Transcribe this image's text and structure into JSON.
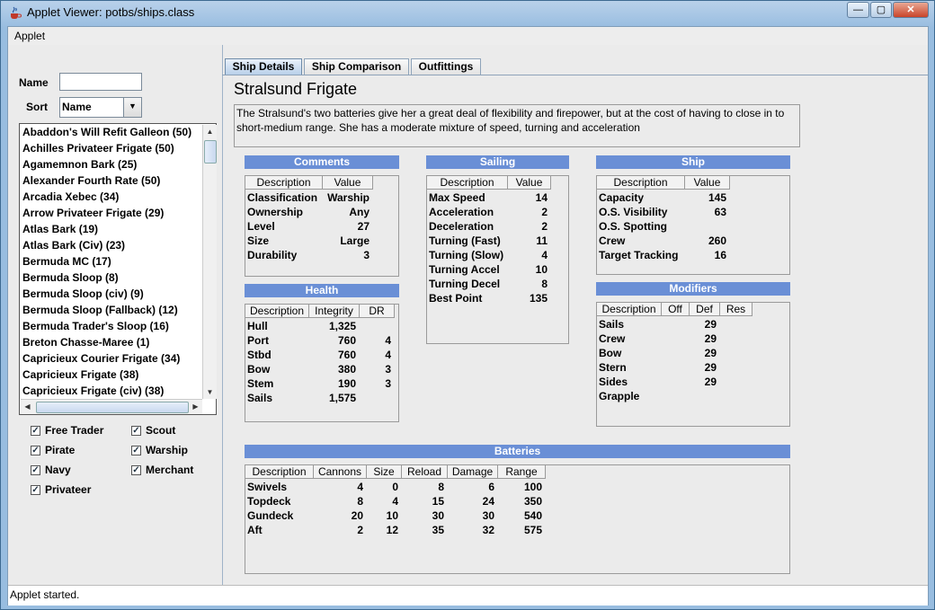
{
  "window": {
    "title": "Applet Viewer: potbs/ships.class",
    "menu": "Applet",
    "status": "Applet started.",
    "min_symbol": "—",
    "max_symbol": "▢",
    "close_symbol": "✕"
  },
  "left": {
    "name_label": "Name",
    "name_value": "",
    "sort_label": "Sort",
    "sort_value": "Name",
    "ships": [
      "Abaddon's Will Refit Galleon (50)",
      "Achilles Privateer Frigate (50)",
      "Agamemnon Bark (25)",
      "Alexander Fourth Rate (50)",
      "Arcadia Xebec (34)",
      "Arrow Privateer Frigate (29)",
      "Atlas Bark (19)",
      "Atlas Bark (Civ) (23)",
      "Bermuda MC (17)",
      "Bermuda Sloop (8)",
      "Bermuda Sloop (civ) (9)",
      "Bermuda Sloop (Fallback) (12)",
      "Bermuda Trader's Sloop (16)",
      "Breton Chasse-Maree (1)",
      "Capricieux Courier Frigate (34)",
      "Capricieux Frigate (38)",
      "Capricieux Frigate (civ) (38)"
    ],
    "filters": [
      {
        "label": "Free Trader",
        "checked": true
      },
      {
        "label": "Scout",
        "checked": true
      },
      {
        "label": "Pirate",
        "checked": true
      },
      {
        "label": "Warship",
        "checked": true
      },
      {
        "label": "Navy",
        "checked": true
      },
      {
        "label": "Merchant",
        "checked": true
      },
      {
        "label": "Privateer",
        "checked": true
      }
    ]
  },
  "tabs": [
    "Ship Details",
    "Ship Comparison",
    "Outfittings"
  ],
  "details": {
    "ship_name": "Stralsund Frigate",
    "description": "The Stralsund's two batteries give her a great deal of flexibility and firepower, but at the cost of having to close in to short-medium range. She has a moderate mixture of speed, turning and acceleration",
    "comments": {
      "title": "Comments",
      "headers": [
        "Description",
        "Value"
      ],
      "rows": [
        [
          "Classification",
          "Warship"
        ],
        [
          "Ownership",
          "Any"
        ],
        [
          "Level",
          "27"
        ],
        [
          "Size",
          "Large"
        ],
        [
          "Durability",
          "3"
        ]
      ]
    },
    "sailing": {
      "title": "Sailing",
      "headers": [
        "Description",
        "Value"
      ],
      "rows": [
        [
          "Max Speed",
          "14"
        ],
        [
          "Acceleration",
          "2"
        ],
        [
          "Deceleration",
          "2"
        ],
        [
          "Turning (Fast)",
          "11"
        ],
        [
          "Turning (Slow)",
          "4"
        ],
        [
          "Turning Accel",
          "10"
        ],
        [
          "Turning Decel",
          "8"
        ],
        [
          "Best Point",
          "135"
        ]
      ]
    },
    "ship": {
      "title": "Ship",
      "headers": [
        "Description",
        "Value"
      ],
      "rows": [
        [
          "Capacity",
          "145"
        ],
        [
          "O.S. Visibility",
          "63"
        ],
        [
          "O.S. Spotting",
          ""
        ],
        [
          "Crew",
          "260"
        ],
        [
          "Target Tracking",
          "16"
        ]
      ]
    },
    "health": {
      "title": "Health",
      "headers": [
        "Description",
        "Integrity",
        "DR"
      ],
      "rows": [
        [
          "Hull",
          "1,325",
          ""
        ],
        [
          "Port",
          "760",
          "4"
        ],
        [
          "Stbd",
          "760",
          "4"
        ],
        [
          "Bow",
          "380",
          "3"
        ],
        [
          "Stem",
          "190",
          "3"
        ],
        [
          "Sails",
          "1,575",
          ""
        ]
      ]
    },
    "modifiers": {
      "title": "Modifiers",
      "headers": [
        "Description",
        "Off",
        "Def",
        "Res"
      ],
      "rows": [
        [
          "Sails",
          "",
          "29",
          ""
        ],
        [
          "Crew",
          "",
          "29",
          ""
        ],
        [
          "Bow",
          "",
          "29",
          ""
        ],
        [
          "Stern",
          "",
          "29",
          ""
        ],
        [
          "Sides",
          "",
          "29",
          ""
        ],
        [
          "Grapple",
          "",
          "",
          ""
        ]
      ]
    },
    "batteries": {
      "title": "Batteries",
      "headers": [
        "Description",
        "Cannons",
        "Size",
        "Reload",
        "Damage",
        "Range"
      ],
      "rows": [
        [
          "Swivels",
          "4",
          "0",
          "8",
          "6",
          "100"
        ],
        [
          "Topdeck",
          "8",
          "4",
          "15",
          "24",
          "350"
        ],
        [
          "Gundeck",
          "20",
          "10",
          "30",
          "30",
          "540"
        ],
        [
          "Aft",
          "2",
          "12",
          "35",
          "32",
          "575"
        ]
      ]
    }
  }
}
